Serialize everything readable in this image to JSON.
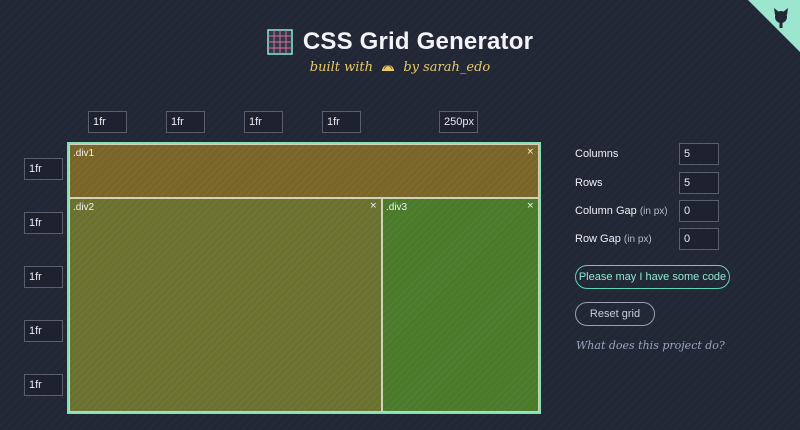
{
  "header": {
    "title": "CSS Grid Generator",
    "subtitle_prefix": "built with",
    "subtitle_suffix": "by sarah_edo",
    "logo_icon": "grid-icon",
    "corner_icon": "github-octocat-icon"
  },
  "grid": {
    "column_sizes": [
      "1fr",
      "1fr",
      "1fr",
      "1fr",
      "250px"
    ],
    "row_sizes": [
      "1fr",
      "1fr",
      "1fr",
      "1fr",
      "1fr"
    ],
    "areas": [
      {
        "name": ".div1",
        "color": "#7a6528",
        "close": "×"
      },
      {
        "name": ".div2",
        "color": "#6b7230",
        "close": "×"
      },
      {
        "name": ".div3",
        "color": "#4a7a2a",
        "close": "×"
      }
    ],
    "border_color": "#87e0b3"
  },
  "controls": {
    "columns_label": "Columns",
    "columns_value": "5",
    "rows_label": "Rows",
    "rows_value": "5",
    "column_gap_label": "Column Gap",
    "column_gap_unit": "(in px)",
    "column_gap_value": "0",
    "row_gap_label": "Row Gap",
    "row_gap_unit": "(in px)",
    "row_gap_value": "0",
    "code_button": "Please may I have some code",
    "reset_button": "Reset grid",
    "about_link": "What does this project do?"
  }
}
